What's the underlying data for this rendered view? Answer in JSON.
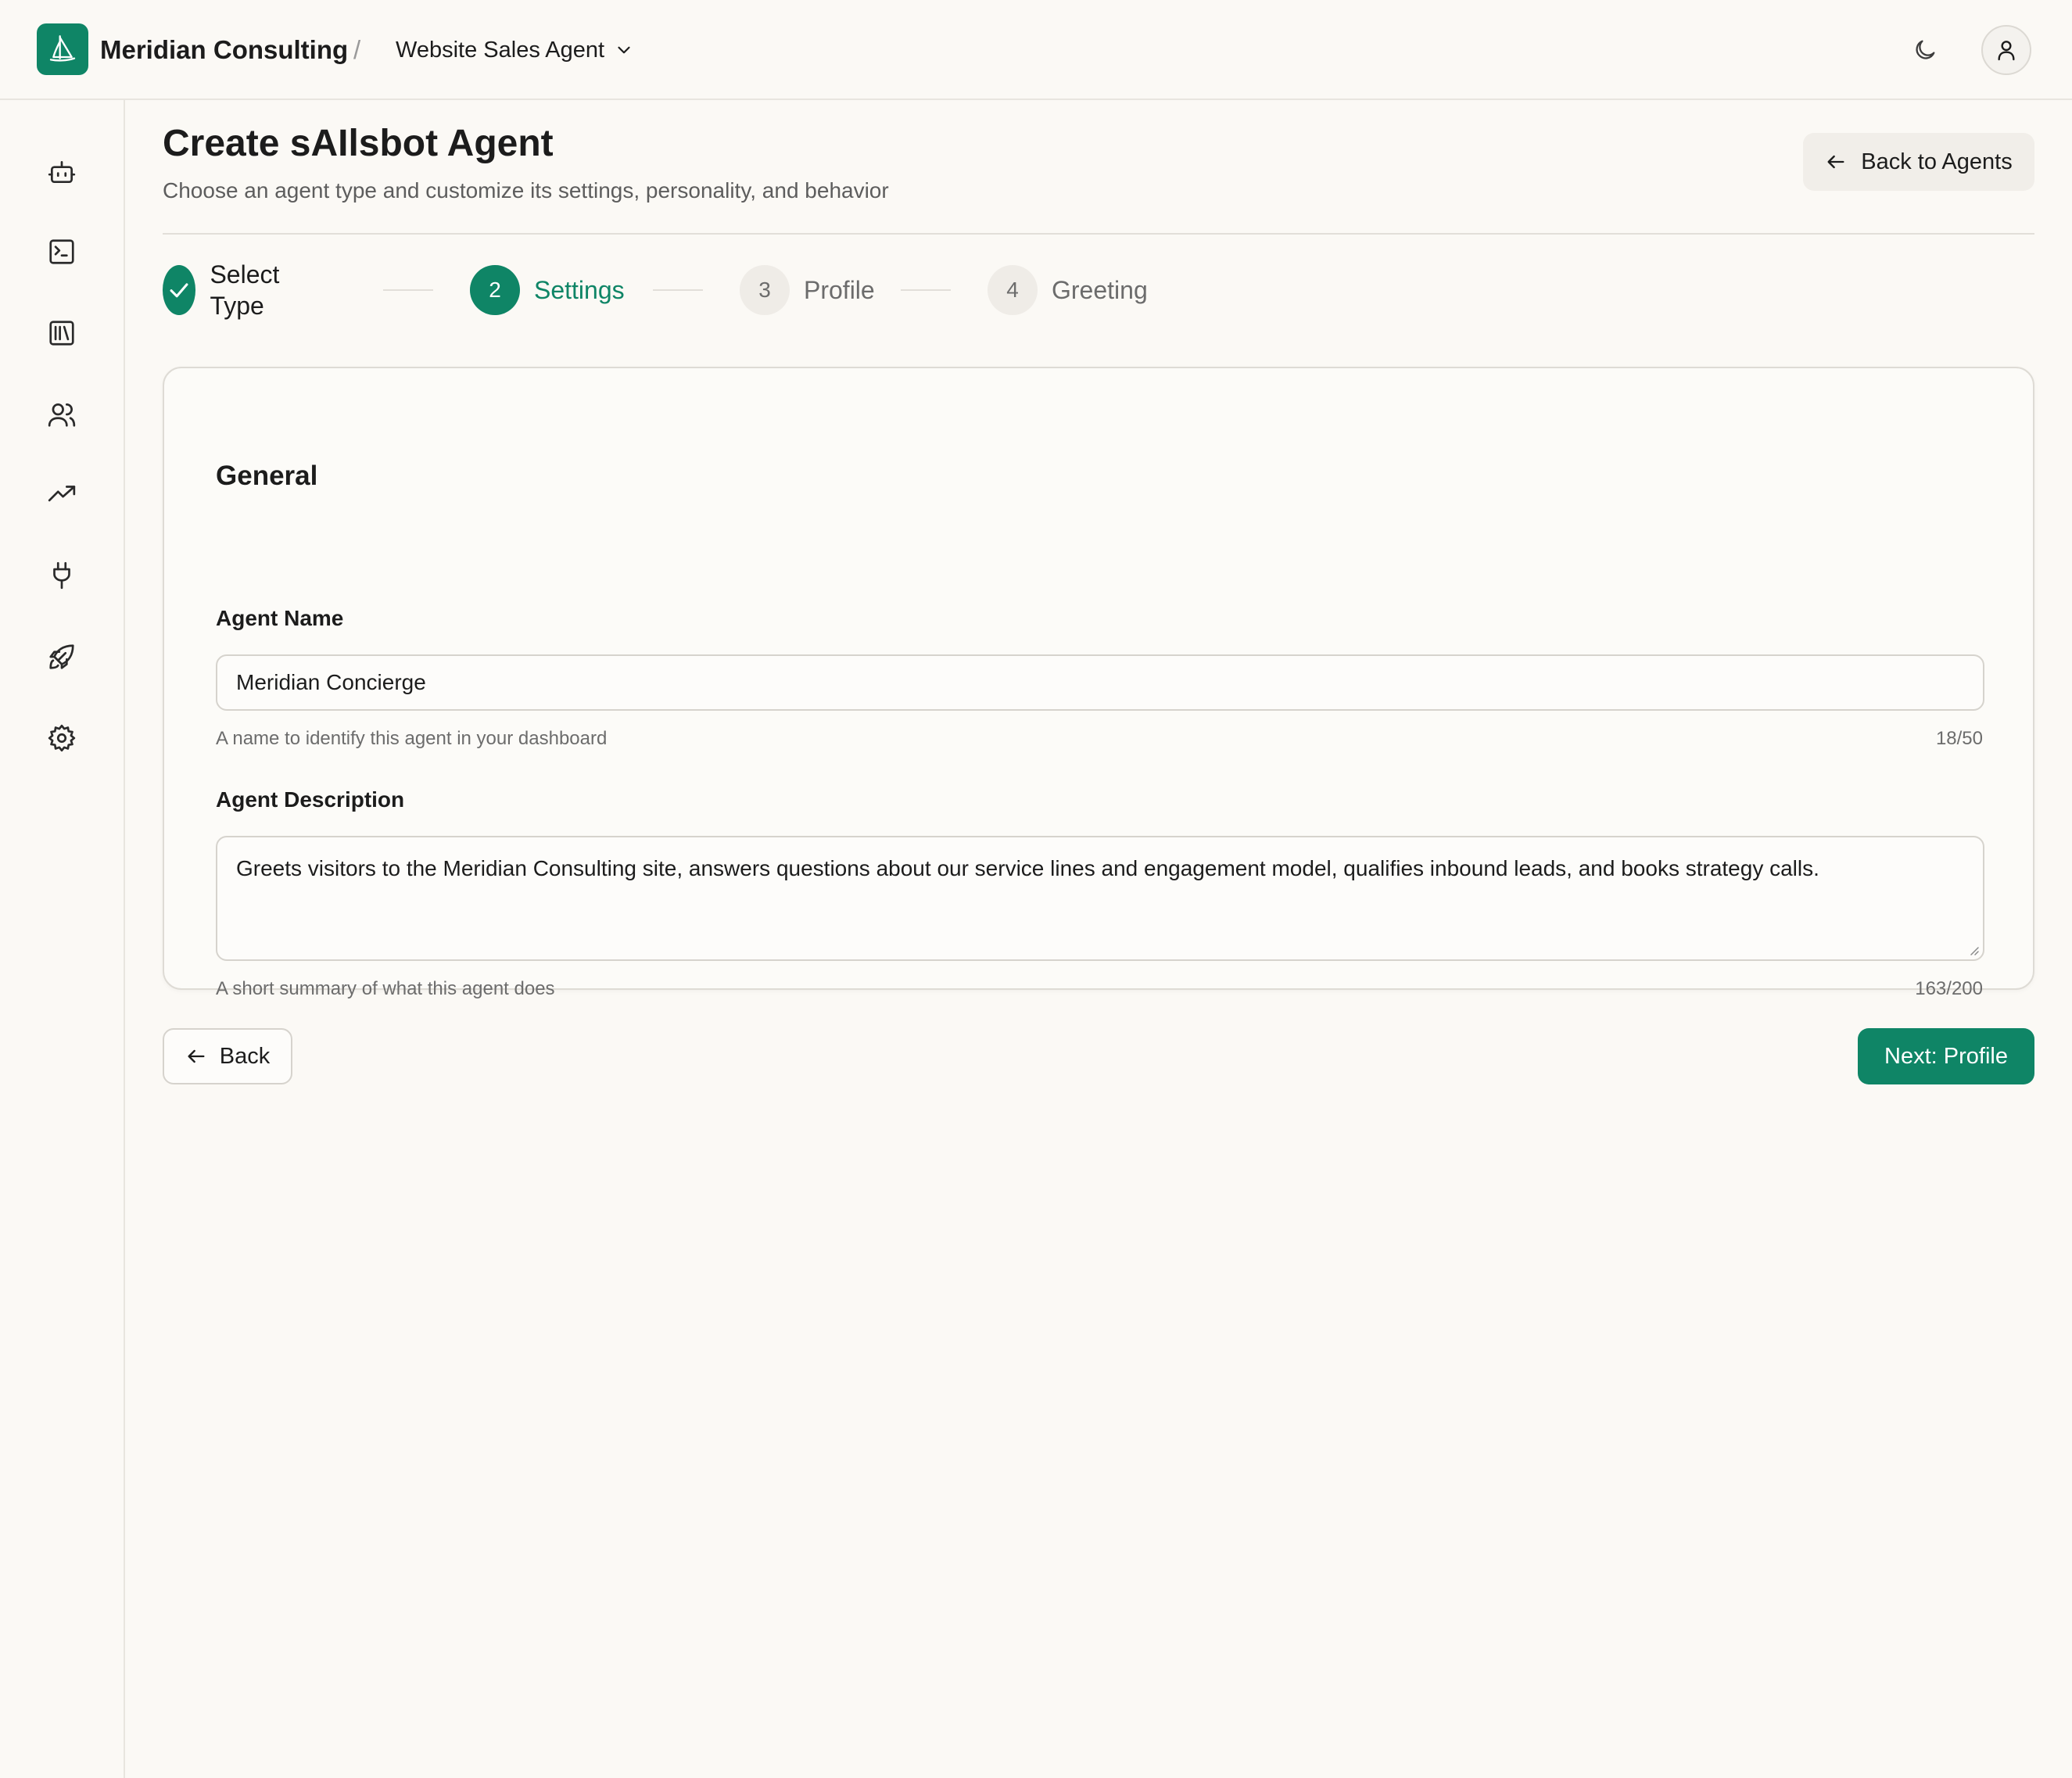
{
  "header": {
    "org_name": "Meridian Consulting",
    "separator": "/",
    "agent_switcher_label": "Website Sales Agent",
    "brand_color": "#0f8566",
    "icons": {
      "logo": "sailboat-icon",
      "switcher": "chevron-down-icon",
      "theme": "moon-icon",
      "avatar": "user-icon"
    }
  },
  "sidebar": {
    "items": [
      {
        "icon": "bot-icon"
      },
      {
        "icon": "terminal-icon"
      },
      {
        "icon": "library-icon"
      },
      {
        "icon": "users-icon"
      },
      {
        "icon": "trending-up-icon"
      },
      {
        "icon": "plug-icon"
      },
      {
        "icon": "rocket-icon"
      },
      {
        "icon": "settings-icon"
      }
    ]
  },
  "page": {
    "title": "Create sAIlsbot Agent",
    "subtitle": "Choose an agent type and customize its settings, personality, and behavior",
    "back_to_agents_label": "Back to Agents"
  },
  "stepper": {
    "steps": [
      {
        "number": "1",
        "label": "Select Type",
        "state": "done"
      },
      {
        "number": "2",
        "label": "Settings",
        "state": "active"
      },
      {
        "number": "3",
        "label": "Profile",
        "state": "pending"
      },
      {
        "number": "4",
        "label": "Greeting",
        "state": "pending"
      }
    ]
  },
  "form": {
    "section_title": "General",
    "agent_name": {
      "label": "Agent Name",
      "value": "Meridian Concierge",
      "hint": "A name to identify this agent in your dashboard",
      "counter": "18/50"
    },
    "agent_description": {
      "label": "Agent Description",
      "value": "Greets visitors to the Meridian Consulting site, answers questions about our service lines and engagement model, qualifies inbound leads, and books strategy calls.",
      "hint": "A short summary of what this agent does",
      "counter": "163/200"
    }
  },
  "footer": {
    "back_label": "Back",
    "next_label": "Next: Profile"
  }
}
